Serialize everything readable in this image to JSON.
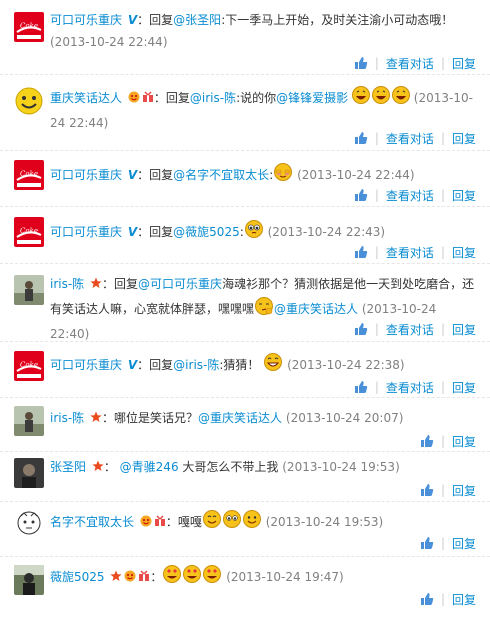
{
  "comments": [
    {
      "name": "可口可乐重庆",
      "badge": "V",
      "prefix": "回复",
      "at": "@张圣阳",
      "text": "下一季马上开始，及时关注渝小可动态哦！",
      "time": "(2013-10-24 22:44)",
      "actions": {
        "view": "查看对话",
        "reply": "回复"
      }
    },
    {
      "name": "重庆笑话达人",
      "badges": [
        "smile-badge",
        "gift-badge"
      ],
      "prefix": "回复",
      "at": "@iris-陈",
      "text": "说的你",
      "at2": "@锋锋爱摄影",
      "time": "(2013-10-24 22:44)",
      "actions": {
        "view": "查看对话",
        "reply": "回复"
      }
    },
    {
      "name": "可口可乐重庆",
      "badge": "V",
      "prefix": "回复",
      "at": "@名字不宜取太长",
      "time": "(2013-10-24 22:44)",
      "actions": {
        "view": "查看对话",
        "reply": "回复"
      }
    },
    {
      "name": "可口可乐重庆",
      "badge": "V",
      "prefix": "回复",
      "at": "@薇旎5025",
      "time": "(2013-10-24 22:43)",
      "actions": {
        "view": "查看对话",
        "reply": "回复"
      }
    },
    {
      "name": "iris-陈",
      "prefix": "回复",
      "at": "@可口可乐重庆",
      "text": "海魂衫那个？猜测依据是他一天到处吃磨合，还有笑话达人嘛，心宽就体胖瑟，嘿嘿嘿",
      "at2": "@重庆笑话达人",
      "time": "(2013-10-24 22:40)",
      "actions": {
        "view": "查看对话",
        "reply": "回复"
      }
    },
    {
      "name": "可口可乐重庆",
      "badge": "V",
      "prefix": "回复",
      "at": "@iris-陈",
      "text": "猜猜！",
      "time": "(2013-10-24 22:38)",
      "actions": {
        "view": "查看对话",
        "reply": "回复"
      }
    },
    {
      "name": "iris-陈",
      "text": "哪位是笑话兄？",
      "at": "@重庆笑话达人",
      "time": "(2013-10-24 20:07)",
      "actions": {
        "reply": "回复"
      }
    },
    {
      "name": "张圣阳",
      "at": "@青骓246",
      "text": "大哥怎么不带上我",
      "time": "(2013-10-24 19:53)",
      "actions": {
        "reply": "回复"
      }
    },
    {
      "name": "名字不宜取太长",
      "text": "嘎嘎",
      "time": "(2013-10-24 19:53)",
      "actions": {
        "reply": "回复"
      }
    },
    {
      "name": "薇旎5025",
      "time": "(2013-10-24 19:47)",
      "actions": {
        "reply": "回复"
      }
    }
  ],
  "colors": {
    "link": "#0a8cd2",
    "timestamp": "#808080",
    "separator": "#cccccc"
  }
}
